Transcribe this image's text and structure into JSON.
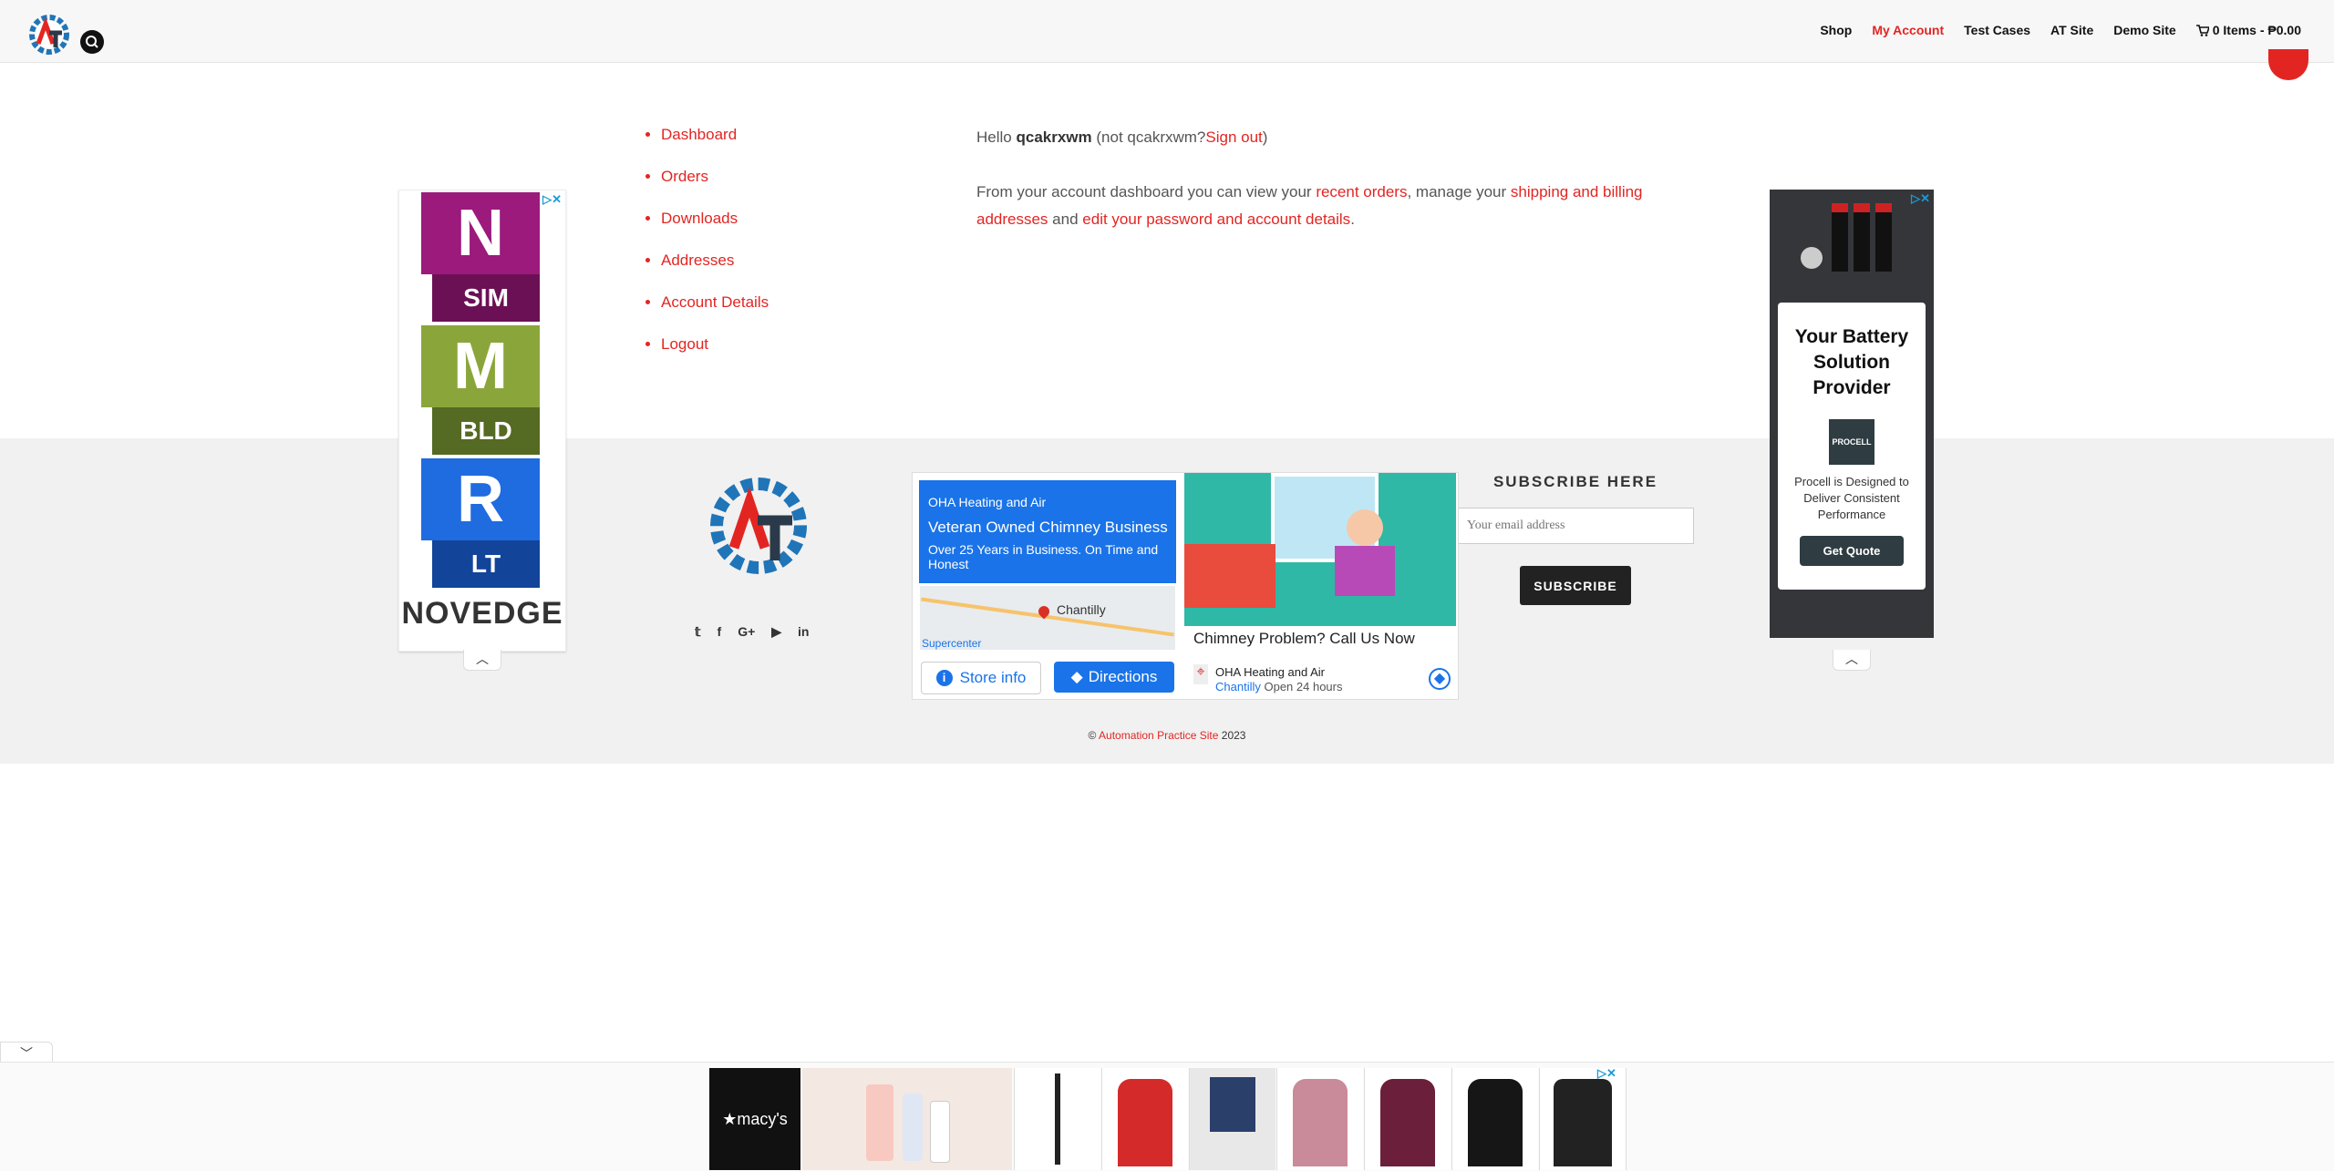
{
  "header": {
    "nav": [
      {
        "label": "Shop",
        "active": false
      },
      {
        "label": "My Account",
        "active": true
      },
      {
        "label": "Test Cases",
        "active": false
      },
      {
        "label": "AT Site",
        "active": false
      },
      {
        "label": "Demo Site",
        "active": false
      }
    ],
    "cart_label": "0 Items - ₱0.00",
    "accent": "#e32522"
  },
  "account": {
    "nav": [
      "Dashboard",
      "Orders",
      "Downloads",
      "Addresses",
      "Account Details",
      "Logout"
    ],
    "hello": "Hello",
    "username": "qcakrxwm",
    "not_prefix": "(not qcakrxwm?",
    "sign_out": "Sign out",
    "close_paren": ")",
    "intro_1": "From your account dashboard you can view your",
    "recent_orders": "recent orders",
    "intro_2": ", manage your",
    "addresses_link": "shipping and billing addresses",
    "intro_3": "and",
    "password_link": "edit your password and account details",
    "intro_end": "."
  },
  "footer": {
    "subscribe_title": "SUBSCRIBE HERE",
    "email_placeholder": "Your email address",
    "subscribe_button": "SUBSCRIBE",
    "copyright_symbol": "©",
    "copyright_link": "Automation Practice Site",
    "copyright_year": "2023",
    "social": [
      "twitter-icon",
      "facebook-icon",
      "google-plus-icon",
      "youtube-icon",
      "linkedin-icon"
    ]
  },
  "ads": {
    "left": {
      "tiles": [
        {
          "letter": "N",
          "label": "SIM",
          "color": "#9b1a7c",
          "dark": "#6b1054"
        },
        {
          "letter": "M",
          "label": "BLD",
          "color": "#8aa63b",
          "dark": "#556a22"
        },
        {
          "letter": "R",
          "label": "LT",
          "color": "#1f6be0",
          "dark": "#12449a"
        }
      ],
      "brand": "NOVEDGE"
    },
    "middle": {
      "advertiser": "OHA Heating and Air",
      "headline": "Veteran Owned Chimney Business",
      "body": "Over 25 Years in Business. On Time and Honest",
      "map_city": "Chantilly",
      "map_store": "Supercenter",
      "store_info": "Store info",
      "directions": "Directions",
      "promo": "Chimney Problem? Call Us Now",
      "business": "OHA Heating and Air",
      "city": "Chantilly",
      "hours": "Open 24 hours"
    },
    "right": {
      "title": "Your Battery Solution Provider",
      "brand": "PROCELL",
      "desc": "Procell is Designed to Deliver Consistent Performance",
      "button": "Get Quote"
    },
    "bottom": {
      "brand": "★macy's"
    }
  }
}
